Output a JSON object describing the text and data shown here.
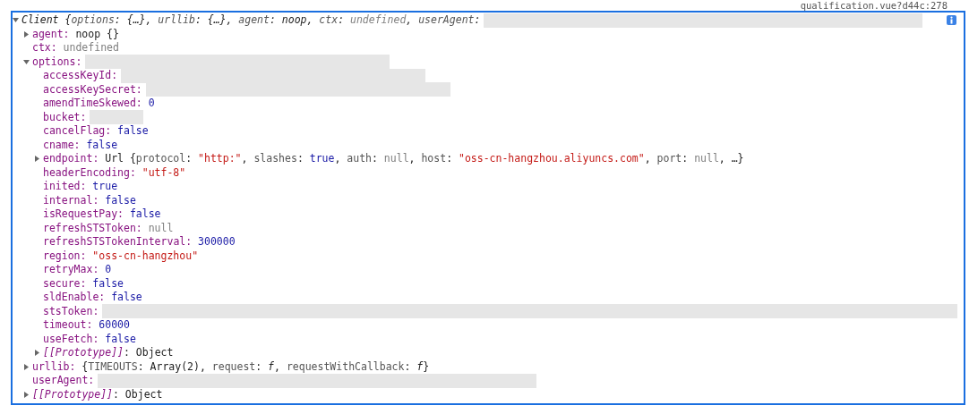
{
  "source_link": "qualification.vue?d44c:278",
  "tree": [
    {
      "kind": "summary",
      "expanded": true,
      "redaction": {
        "kind": "wide"
      },
      "tokens": [
        {
          "t": "Client {",
          "kind": "plain"
        },
        {
          "t": "options",
          "kind": "pkey"
        },
        {
          "t": ": {…}, ",
          "kind": "plain"
        },
        {
          "t": "urllib",
          "kind": "pkey"
        },
        {
          "t": ": {…}, ",
          "kind": "plain"
        },
        {
          "t": "agent",
          "kind": "pkey"
        },
        {
          "t": ": noop, ",
          "kind": "plain"
        },
        {
          "t": "ctx",
          "kind": "pkey"
        },
        {
          "t": ": ",
          "kind": "plain"
        },
        {
          "t": "undefined",
          "kind": "null"
        },
        {
          "t": ", ",
          "kind": "plain"
        },
        {
          "t": "userAgent",
          "kind": "pkey"
        },
        {
          "t": ":",
          "kind": "plain"
        }
      ],
      "children": [
        {
          "kind": "property",
          "key": "agent:",
          "expanded": false,
          "tokens": [
            {
              "t": "noop {}",
              "kind": "plain"
            }
          ]
        },
        {
          "kind": "property",
          "key": "ctx:",
          "tokens": [
            {
              "t": "undefined",
              "kind": "null"
            }
          ]
        },
        {
          "kind": "property",
          "key": "options:",
          "expanded": true,
          "redaction": {
            "kind": "medium"
          },
          "children": [
            {
              "kind": "property",
              "key": "accessKeyId:",
              "redaction": {
                "kind": "medium"
              }
            },
            {
              "kind": "property",
              "key": "accessKeySecret:",
              "redaction": {
                "kind": "medium"
              }
            },
            {
              "kind": "property",
              "key": "amendTimeSkewed:",
              "tokens": [
                {
                  "t": "0",
                  "kind": "number"
                }
              ]
            },
            {
              "kind": "property",
              "key": "bucket:",
              "redaction": {
                "kind": "short"
              }
            },
            {
              "kind": "property",
              "key": "cancelFlag:",
              "tokens": [
                {
                  "t": "false",
                  "kind": "number"
                }
              ]
            },
            {
              "kind": "property",
              "key": "cname:",
              "tokens": [
                {
                  "t": "false",
                  "kind": "number"
                }
              ]
            },
            {
              "kind": "property",
              "key": "endpoint:",
              "expanded": false,
              "tokens": [
                {
                  "t": "Url {",
                  "kind": "plain"
                },
                {
                  "t": "protocol",
                  "kind": "pkey"
                },
                {
                  "t": ": ",
                  "kind": "plain"
                },
                {
                  "t": "\"http:\"",
                  "kind": "string"
                },
                {
                  "t": ", ",
                  "kind": "plain"
                },
                {
                  "t": "slashes",
                  "kind": "pkey"
                },
                {
                  "t": ": ",
                  "kind": "plain"
                },
                {
                  "t": "true",
                  "kind": "number"
                },
                {
                  "t": ", ",
                  "kind": "plain"
                },
                {
                  "t": "auth",
                  "kind": "pkey"
                },
                {
                  "t": ": ",
                  "kind": "plain"
                },
                {
                  "t": "null",
                  "kind": "null"
                },
                {
                  "t": ", ",
                  "kind": "plain"
                },
                {
                  "t": "host",
                  "kind": "pkey"
                },
                {
                  "t": ": ",
                  "kind": "plain"
                },
                {
                  "t": "\"oss-cn-hangzhou.aliyuncs.com\"",
                  "kind": "string"
                },
                {
                  "t": ", ",
                  "kind": "plain"
                },
                {
                  "t": "port",
                  "kind": "pkey"
                },
                {
                  "t": ": ",
                  "kind": "plain"
                },
                {
                  "t": "null",
                  "kind": "null"
                },
                {
                  "t": ", …}",
                  "kind": "plain"
                }
              ]
            },
            {
              "kind": "property",
              "key": "headerEncoding:",
              "tokens": [
                {
                  "t": "\"utf-8\"",
                  "kind": "string"
                }
              ]
            },
            {
              "kind": "property",
              "key": "inited:",
              "tokens": [
                {
                  "t": "true",
                  "kind": "number"
                }
              ]
            },
            {
              "kind": "property",
              "key": "internal:",
              "tokens": [
                {
                  "t": "false",
                  "kind": "number"
                }
              ]
            },
            {
              "kind": "property",
              "key": "isRequestPay:",
              "tokens": [
                {
                  "t": "false",
                  "kind": "number"
                }
              ]
            },
            {
              "kind": "property",
              "key": "refreshSTSToken:",
              "tokens": [
                {
                  "t": "null",
                  "kind": "null"
                }
              ]
            },
            {
              "kind": "property",
              "key": "refreshSTSTokenInterval:",
              "tokens": [
                {
                  "t": "300000",
                  "kind": "number"
                }
              ]
            },
            {
              "kind": "property",
              "key": "region:",
              "tokens": [
                {
                  "t": "\"oss-cn-hangzhou\"",
                  "kind": "string"
                }
              ]
            },
            {
              "kind": "property",
              "key": "retryMax:",
              "tokens": [
                {
                  "t": "0",
                  "kind": "number"
                }
              ]
            },
            {
              "kind": "property",
              "key": "secure:",
              "tokens": [
                {
                  "t": "false",
                  "kind": "number"
                }
              ]
            },
            {
              "kind": "property",
              "key": "sldEnable:",
              "tokens": [
                {
                  "t": "false",
                  "kind": "number"
                }
              ]
            },
            {
              "kind": "property",
              "key": "stsToken:",
              "redaction": {
                "kind": "full"
              }
            },
            {
              "kind": "property",
              "key": "timeout:",
              "tokens": [
                {
                  "t": "60000",
                  "kind": "number"
                }
              ]
            },
            {
              "kind": "property",
              "key": "useFetch:",
              "tokens": [
                {
                  "t": "false",
                  "kind": "number"
                }
              ]
            },
            {
              "kind": "prototype",
              "key": "[[Prototype]]",
              "expanded": false,
              "tokens": [
                {
                  "t": ": Object",
                  "kind": "plain"
                }
              ]
            }
          ]
        },
        {
          "kind": "property",
          "key": "urllib:",
          "expanded": false,
          "tokens": [
            {
              "t": "{",
              "kind": "plain"
            },
            {
              "t": "TIMEOUTS",
              "kind": "pkey"
            },
            {
              "t": ": Array(2), ",
              "kind": "plain"
            },
            {
              "t": "request",
              "kind": "pkey"
            },
            {
              "t": ": ",
              "kind": "plain"
            },
            {
              "t": "f",
              "kind": "func"
            },
            {
              "t": ", ",
              "kind": "plain"
            },
            {
              "t": "requestWithCallback",
              "kind": "pkey"
            },
            {
              "t": ": ",
              "kind": "plain"
            },
            {
              "t": "f",
              "kind": "func"
            },
            {
              "t": "}",
              "kind": "plain"
            }
          ]
        },
        {
          "kind": "property",
          "key": "userAgent:",
          "redaction": {
            "kind": "wide"
          }
        },
        {
          "kind": "prototype",
          "key": "[[Prototype]]",
          "expanded": false,
          "tokens": [
            {
              "t": ": Object",
              "kind": "plain"
            }
          ]
        }
      ]
    }
  ]
}
